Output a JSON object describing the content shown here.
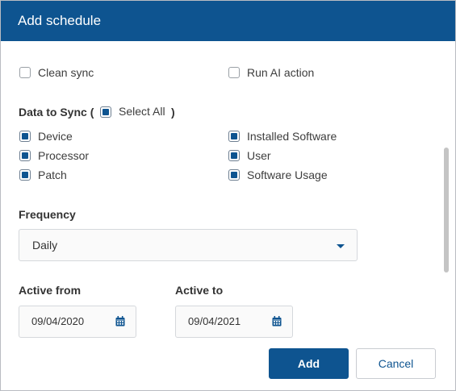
{
  "dialog": {
    "title": "Add schedule"
  },
  "options": {
    "clean_sync": {
      "label": "Clean sync",
      "checked": false
    },
    "run_ai_action": {
      "label": "Run AI action",
      "checked": false
    }
  },
  "data_to_sync": {
    "label_prefix": "Data to Sync (",
    "select_all_label": "Select All",
    "label_suffix": ")",
    "items": [
      {
        "label": "Device",
        "checked": true
      },
      {
        "label": "Processor",
        "checked": true
      },
      {
        "label": "Patch",
        "checked": true
      },
      {
        "label": "Installed Software",
        "checked": true
      },
      {
        "label": "User",
        "checked": true
      },
      {
        "label": "Software Usage",
        "checked": true
      }
    ]
  },
  "frequency": {
    "label": "Frequency",
    "value": "Daily"
  },
  "active_from": {
    "label": "Active from",
    "value": "09/04/2020"
  },
  "active_to": {
    "label": "Active to",
    "value": "09/04/2021"
  },
  "buttons": {
    "add": "Add",
    "cancel": "Cancel"
  },
  "colors": {
    "primary": "#0e5490",
    "header_text": "#ffffff"
  }
}
